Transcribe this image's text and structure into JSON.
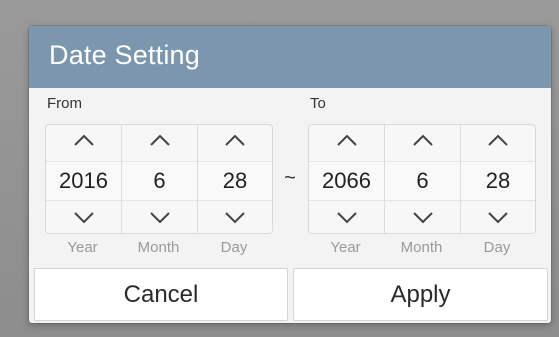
{
  "dialog": {
    "title": "Date Setting"
  },
  "from": {
    "label": "From",
    "year": "2016",
    "month": "6",
    "day": "28"
  },
  "to": {
    "label": "To",
    "year": "2066",
    "month": "6",
    "day": "28"
  },
  "separator": "~",
  "column_labels": {
    "year": "Year",
    "month": "Month",
    "day": "Day"
  },
  "buttons": {
    "cancel": "Cancel",
    "apply": "Apply"
  },
  "colors": {
    "header": "#7c96ad",
    "dialog_background": "#f3f3f3",
    "backdrop": "#8e8e8e"
  },
  "icons": {
    "increment": "chevron-up-icon",
    "decrement": "chevron-down-icon"
  }
}
